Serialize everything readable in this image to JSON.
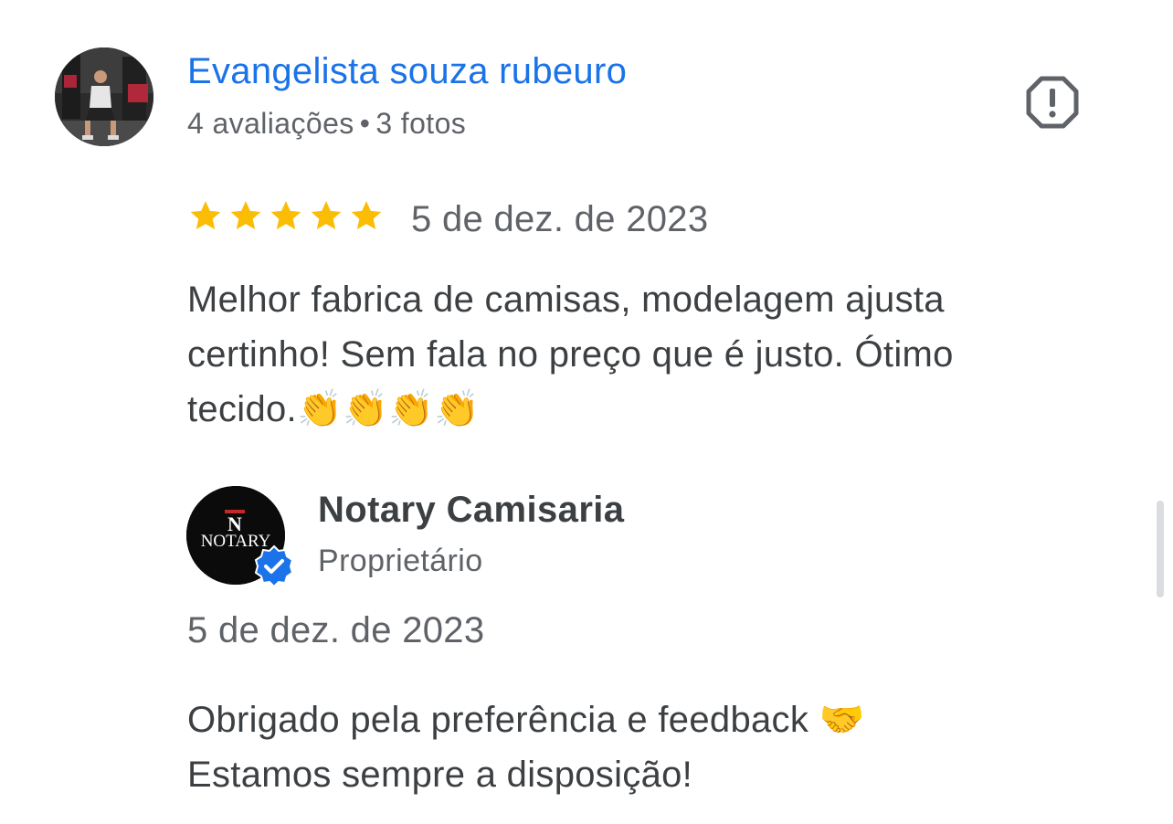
{
  "reviewer": {
    "name": "Evangelista souza rubeuro",
    "reviews_count": "4 avaliações",
    "separator": "•",
    "photos_count": "3 fotos"
  },
  "review": {
    "rating": 5,
    "max_rating": 5,
    "star_color": "#fbbc04",
    "date": "5 de dez. de 2023",
    "text": "Melhor fabrica de camisas, modelagem ajusta certinho! Sem fala no preço que é justo. Ótimo tecido.👏👏👏👏"
  },
  "owner": {
    "logo_text": "NOTARY",
    "name": "Notary Camisaria",
    "role": "Proprietário",
    "verified_icon": "verified-badge-icon",
    "verified_color": "#1a73e8"
  },
  "reply": {
    "date": "5 de dez. de 2023",
    "line1": "Obrigado pela preferência e feedback 🤝",
    "line2": "Estamos sempre a disposição!"
  },
  "icons": {
    "report": "report-flag-icon"
  },
  "colors": {
    "link_blue": "#1a73e8",
    "text_primary": "#3c4043",
    "text_secondary": "#5f6368"
  }
}
